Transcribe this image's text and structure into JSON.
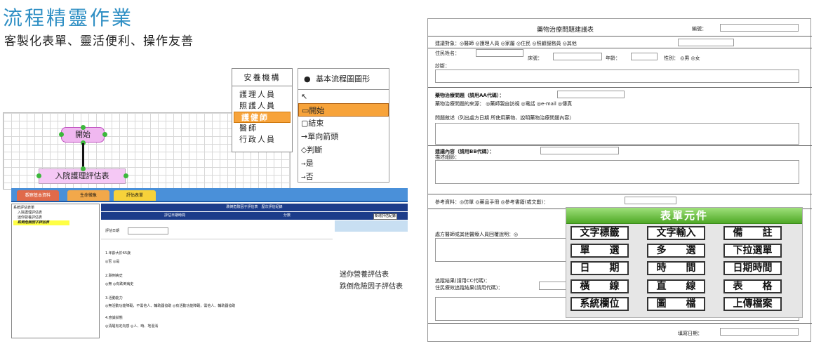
{
  "header": {
    "title": "流程精靈作業",
    "subtitle": "客製化表單、靈活便利、操作友善"
  },
  "org_panel": {
    "title": "安養機構",
    "items": [
      "護理人員",
      "照護人員",
      "護健師",
      "醫師",
      "行政人員"
    ],
    "selected": "護健師"
  },
  "palette": {
    "title": "基本流程圖圖形",
    "items": [
      "開始",
      "結束",
      "單向箭頭",
      "判斷",
      "是",
      "否"
    ],
    "selected": "開始"
  },
  "flow": {
    "start_node": "開始",
    "process_node": "入院護理評估表"
  },
  "nursing_form": {
    "tabs": [
      "觀察基本資料",
      "生命徵象",
      "評估表單"
    ],
    "tree": [
      "系統評估表單",
      "入院護理評估表",
      "迷你營養評估表",
      "跌倒危險因子評估表"
    ],
    "header1": "跌倒危險因子評估表　歷次評估紀錄",
    "header2_cols": [
      "評估日期時間",
      "分數",
      "新增評估紀錄"
    ],
    "date_label": "評估日期",
    "questions": [
      {
        "q": "1.年齡大於65歲",
        "opts": "◎否 ◎是"
      },
      {
        "q": "2.跌倒病史",
        "opts": "◎無 ◎有跌倒病史"
      },
      {
        "q": "3.活動能力",
        "opts": "◎無活動功能障礙，不需他人、輔助器協助 ◎有活動功能障礙，需他人、輔助器協助"
      },
      {
        "q": "4.意識狀態",
        "opts": "◎清醒有定向感 ◎人、時、地混淆"
      }
    ],
    "side_labels": [
      "迷你營養評估表",
      "跌倒危險因子評估表"
    ]
  },
  "rx_form": {
    "title": "藥物治療問題建議表",
    "number_label": "編號：",
    "target_label": "建議對象：◎醫師 ◎護理人員 ◎家屬 ◎住民 ◎照顧服務員 ◎其他",
    "name_label": "住民姓名：",
    "bed_label": "床號：",
    "age_label": "年齡：",
    "gender_label": "性別： ◎男 ◎女",
    "diagnosis_label": "診斷：",
    "problem_label": "藥物治療問題（請用AA代碼）：",
    "source_label": "藥物治療問題的來源： ◎藥師親自訪視 ◎電話 ◎e-mail ◎傳真",
    "narrative_label": "問題敘述（列出處方日期 所使用藥物、說明藥物治療問題內容）",
    "suggestion_label": "建議內容（請用BB代碼）：",
    "desc_label": "描述細節：",
    "reference_label": "參考資料：◎仿單 ◎藥品手冊 ◎參考書籍(或文獻)：",
    "reply_label": "處方醫師或其他醫療人員回覆說明：◎",
    "followup1": "追蹤結果(請用CC代碼)：",
    "followup2": "住民療效追蹤結果(請用代碼)：",
    "fill_date_label": "填寫日期："
  },
  "elements": {
    "title": "表單元件",
    "items": [
      [
        "文字標籤",
        "文字輸入",
        "備　　註"
      ],
      [
        "單　　選",
        "多　　選",
        "下拉選單"
      ],
      [
        "日　　期",
        "時　　間",
        "日期時間"
      ],
      [
        "橫　　線",
        "直　　線",
        "表　　格"
      ],
      [
        "系統欄位",
        "圖　　檔",
        "上傳檔案"
      ]
    ]
  },
  "colors": {
    "title": "#2f8fc4",
    "accent_orange": "#f7a33a",
    "node_pink": "#f0b8f0",
    "tab_blue": "#4a90d9",
    "header_navy": "#1c3c8a",
    "elements_green": "#4fa826"
  }
}
